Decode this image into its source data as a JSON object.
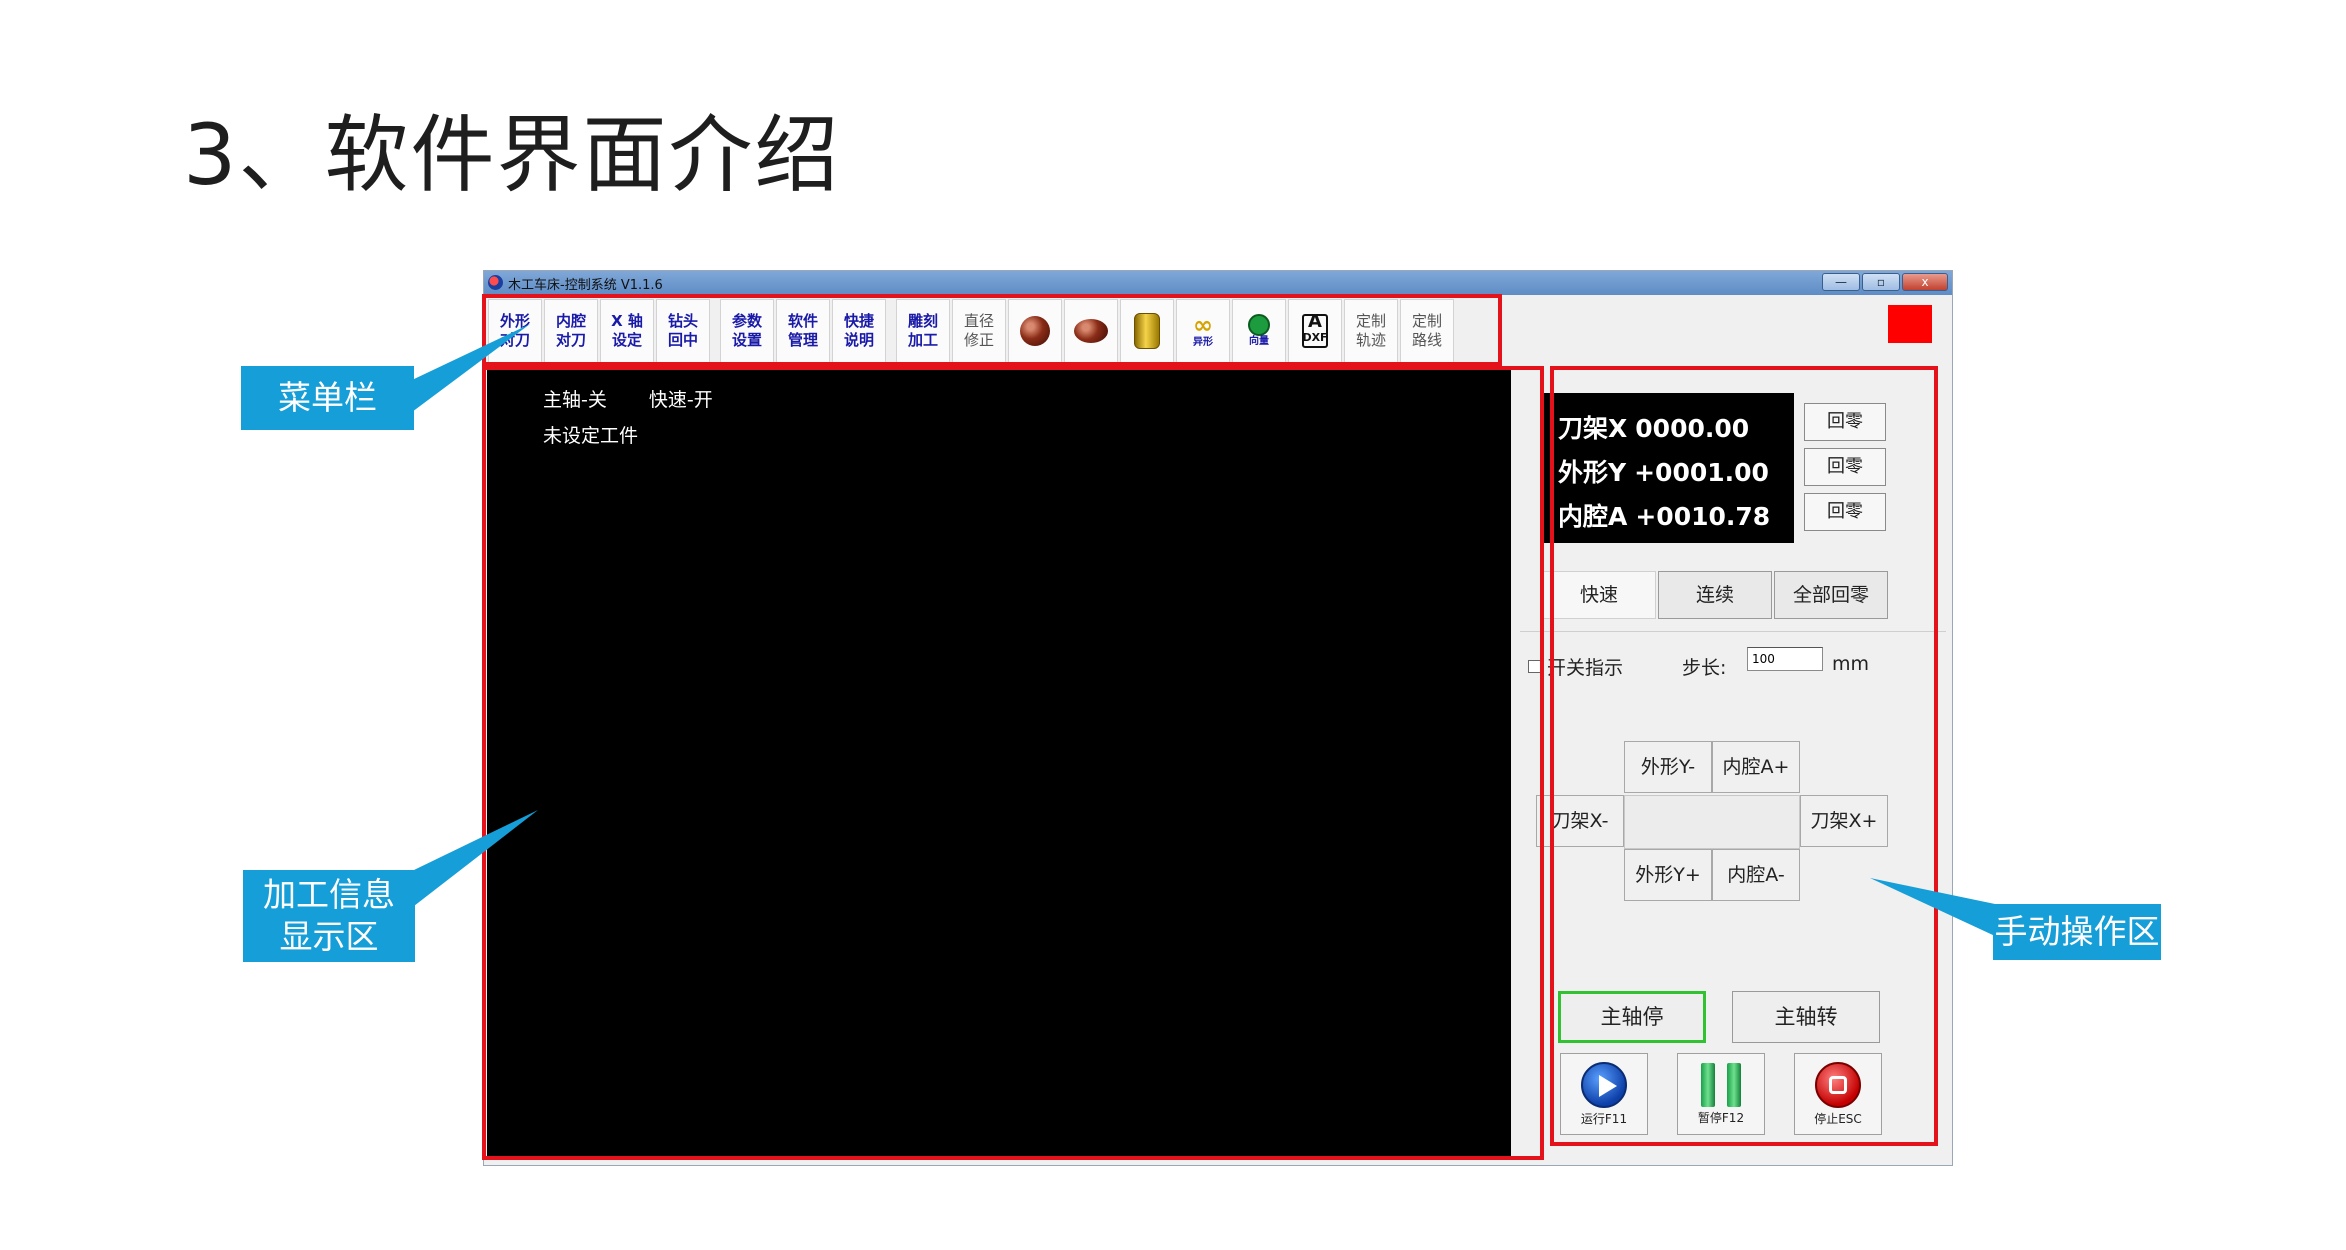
{
  "slide": {
    "title": "3、软件界面介绍"
  },
  "window": {
    "title": "木工车床-控制系统 V1.1.6",
    "controls": [
      "—",
      "▫",
      "x"
    ]
  },
  "toolbar": {
    "items": [
      {
        "label": "外形\n对刀"
      },
      {
        "label": "内腔\n对刀"
      },
      {
        "label": "X 轴\n设定"
      },
      {
        "label": "钻头\n回中"
      },
      {
        "label": "参数\n设置"
      },
      {
        "label": "软件\n管理"
      },
      {
        "label": "快捷\n说明"
      },
      {
        "label": "雕刻\n加工"
      },
      {
        "label": "直径\n修正"
      },
      {
        "icon": "sphere-icon"
      },
      {
        "icon": "ellipsoid-icon"
      },
      {
        "icon": "cylinder-icon"
      },
      {
        "icon": "gourd-icon",
        "label": "异形"
      },
      {
        "icon": "bead-icon",
        "label": "向量"
      },
      {
        "icon": "dxf-icon",
        "label": "DXF"
      },
      {
        "label": "定制\n轨迹"
      },
      {
        "label": "定制\n路线"
      }
    ]
  },
  "display": {
    "spindle_status": "主轴-关",
    "rapid_status": "快速-开",
    "workpiece_status": "未设定工件"
  },
  "manual": {
    "coords": [
      {
        "axis": "刀架X",
        "value": "0000.00"
      },
      {
        "axis": "外形Y",
        "value": "+0001.00"
      },
      {
        "axis": "内腔A",
        "value": "+0010.78"
      }
    ],
    "home_label": "回零",
    "modes": [
      "快速",
      "连续",
      "全部回零"
    ],
    "switch_indicator": "开关指示",
    "step_label": "步长:",
    "step_value": "100",
    "step_unit": "mm",
    "jog": {
      "y_minus": "外形Y-",
      "a_plus": "内腔A+",
      "x_minus": "刀架X-",
      "x_plus": "刀架X+",
      "y_plus": "外形Y+",
      "a_minus": "内腔A-"
    },
    "spindle_stop": "主轴停",
    "spindle_run": "主轴转",
    "run": "运行F11",
    "pause": "暂停F12",
    "stop": "停止ESC"
  },
  "callouts": {
    "menu_bar": "菜单栏",
    "info_display_1": "加工信息",
    "info_display_2": "显示区",
    "manual_area": "手动操作区"
  },
  "colors": {
    "frame": "#e3121b",
    "callout": "#159ed7",
    "indicator": "#ff0000"
  }
}
